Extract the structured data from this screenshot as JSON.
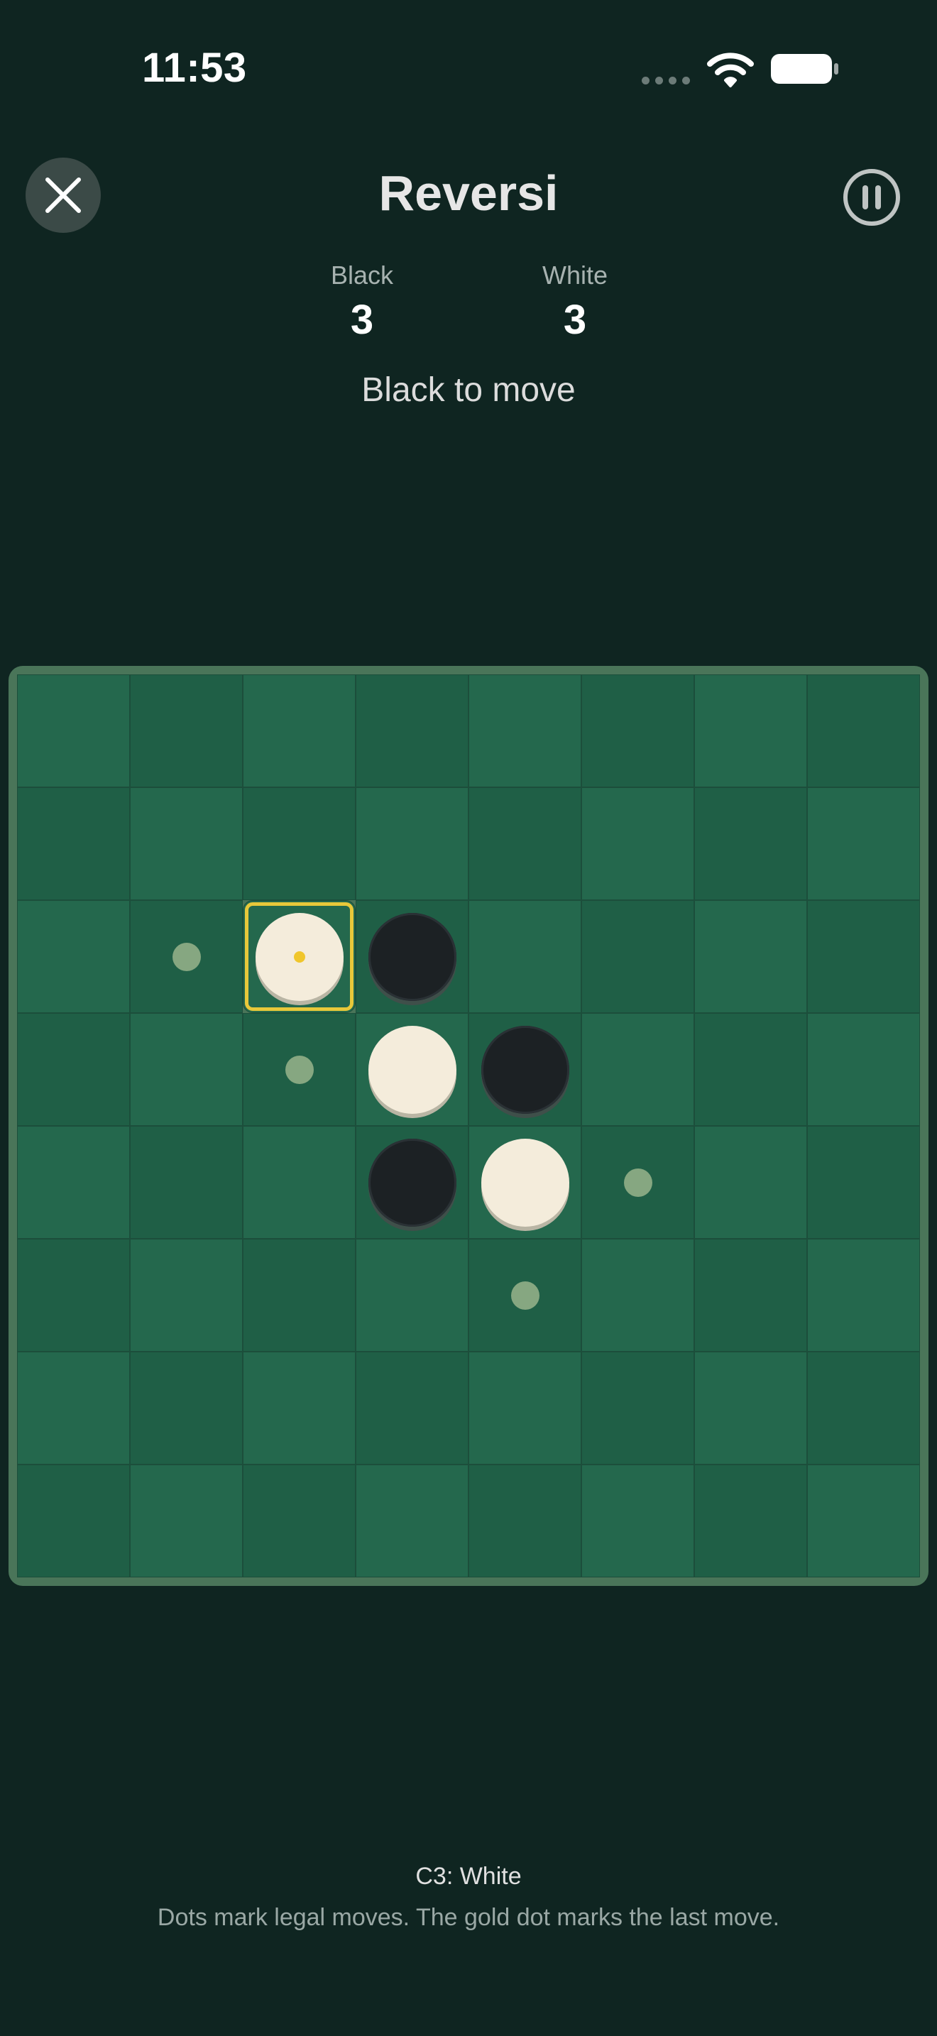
{
  "status_bar": {
    "time": "11:53"
  },
  "header": {
    "title": "Reversi",
    "close_icon": "close-icon",
    "pause_icon": "pause-icon"
  },
  "scores": {
    "black_label": "Black",
    "black_value": "3",
    "white_label": "White",
    "white_value": "3"
  },
  "turn_status": "Black to move",
  "board": {
    "size": 8,
    "discs": [
      {
        "row": 2,
        "col": 2,
        "color": "white"
      },
      {
        "row": 2,
        "col": 3,
        "color": "black"
      },
      {
        "row": 3,
        "col": 3,
        "color": "white"
      },
      {
        "row": 3,
        "col": 4,
        "color": "black"
      },
      {
        "row": 4,
        "col": 3,
        "color": "black"
      },
      {
        "row": 4,
        "col": 4,
        "color": "white"
      }
    ],
    "legal_moves": [
      {
        "row": 2,
        "col": 1
      },
      {
        "row": 3,
        "col": 2
      },
      {
        "row": 4,
        "col": 5
      },
      {
        "row": 5,
        "col": 4
      }
    ],
    "last_move": {
      "row": 2,
      "col": 2
    },
    "colors": {
      "light_square": "#24684d",
      "dark_square": "#1f5f46",
      "last_move_highlight": "#e8c83a",
      "legal_dot": "#86a781"
    }
  },
  "footer": {
    "last_move_text": "C3: White",
    "hint": "Dots mark legal moves. The gold dot marks the last move."
  }
}
